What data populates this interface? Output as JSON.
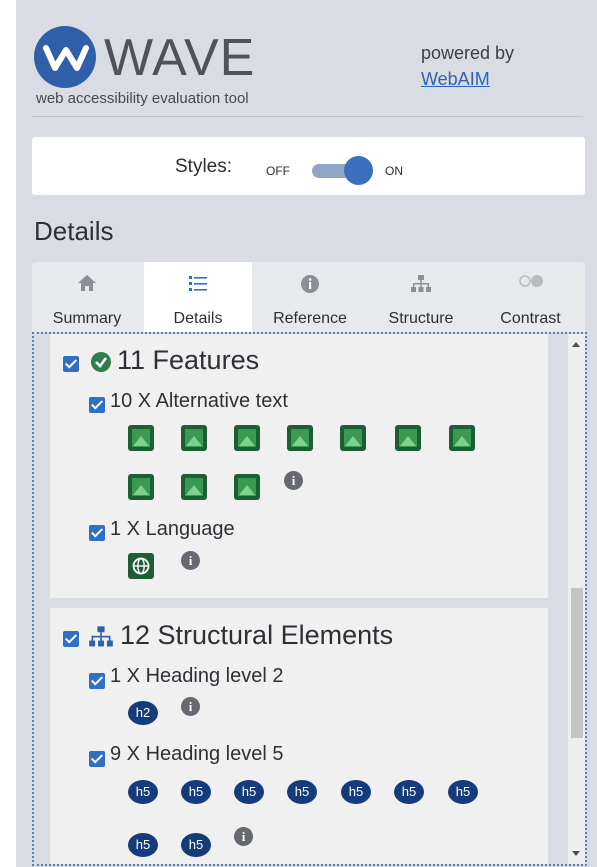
{
  "header": {
    "brand": "WAVE",
    "tagline": "web accessibility evaluation tool",
    "powered_by": "powered by",
    "webaim_link": "WebAIM"
  },
  "styles_toggle": {
    "label": "Styles:",
    "off": "OFF",
    "on": "ON",
    "state": "on"
  },
  "panel_title": "Details",
  "tabs": [
    {
      "label": "Summary",
      "icon": "home-icon"
    },
    {
      "label": "Details",
      "icon": "list-icon",
      "active": true
    },
    {
      "label": "Reference",
      "icon": "info-icon"
    },
    {
      "label": "Structure",
      "icon": "structure-icon"
    },
    {
      "label": "Contrast",
      "icon": "contrast-toggle-icon"
    }
  ],
  "sections": {
    "features": {
      "title": "11 Features",
      "items": [
        {
          "label": "10 X Alternative text",
          "count": 10,
          "icon": "image-icon"
        },
        {
          "label": "1 X Language",
          "count": 1,
          "icon": "globe-icon"
        }
      ]
    },
    "structural": {
      "title": "12 Structural Elements",
      "items": [
        {
          "label": "1 X Heading level 2",
          "count": 1,
          "badge": "h2"
        },
        {
          "label": "9 X Heading level 5",
          "count": 9,
          "badge": "h5"
        }
      ]
    }
  },
  "colors": {
    "accent": "#2f6fc4",
    "feature_green": "#1e5e35",
    "heading_badge": "#163b7a",
    "panel_bg": "#d9dde3"
  }
}
